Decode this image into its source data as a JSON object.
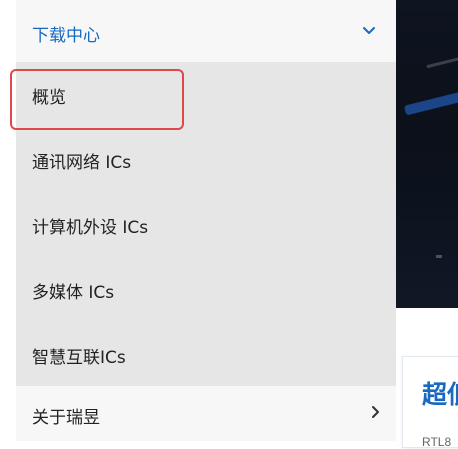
{
  "menu": {
    "header": {
      "label": "下载中心",
      "icon": "chevron-down-icon",
      "accent": "#1769c2"
    },
    "items": [
      {
        "label": "概览"
      },
      {
        "label": "通讯网络 ICs"
      },
      {
        "label": "计算机外设 ICs"
      },
      {
        "label": "多媒体 ICs"
      },
      {
        "label": "智慧互联ICs"
      }
    ],
    "footer": {
      "label": "关于瑞昱",
      "icon": "chevron-right-icon"
    }
  },
  "annotation": {
    "highlight_color": "#e0474c"
  },
  "card": {
    "title": "超低",
    "subtitle": "RTL8"
  }
}
